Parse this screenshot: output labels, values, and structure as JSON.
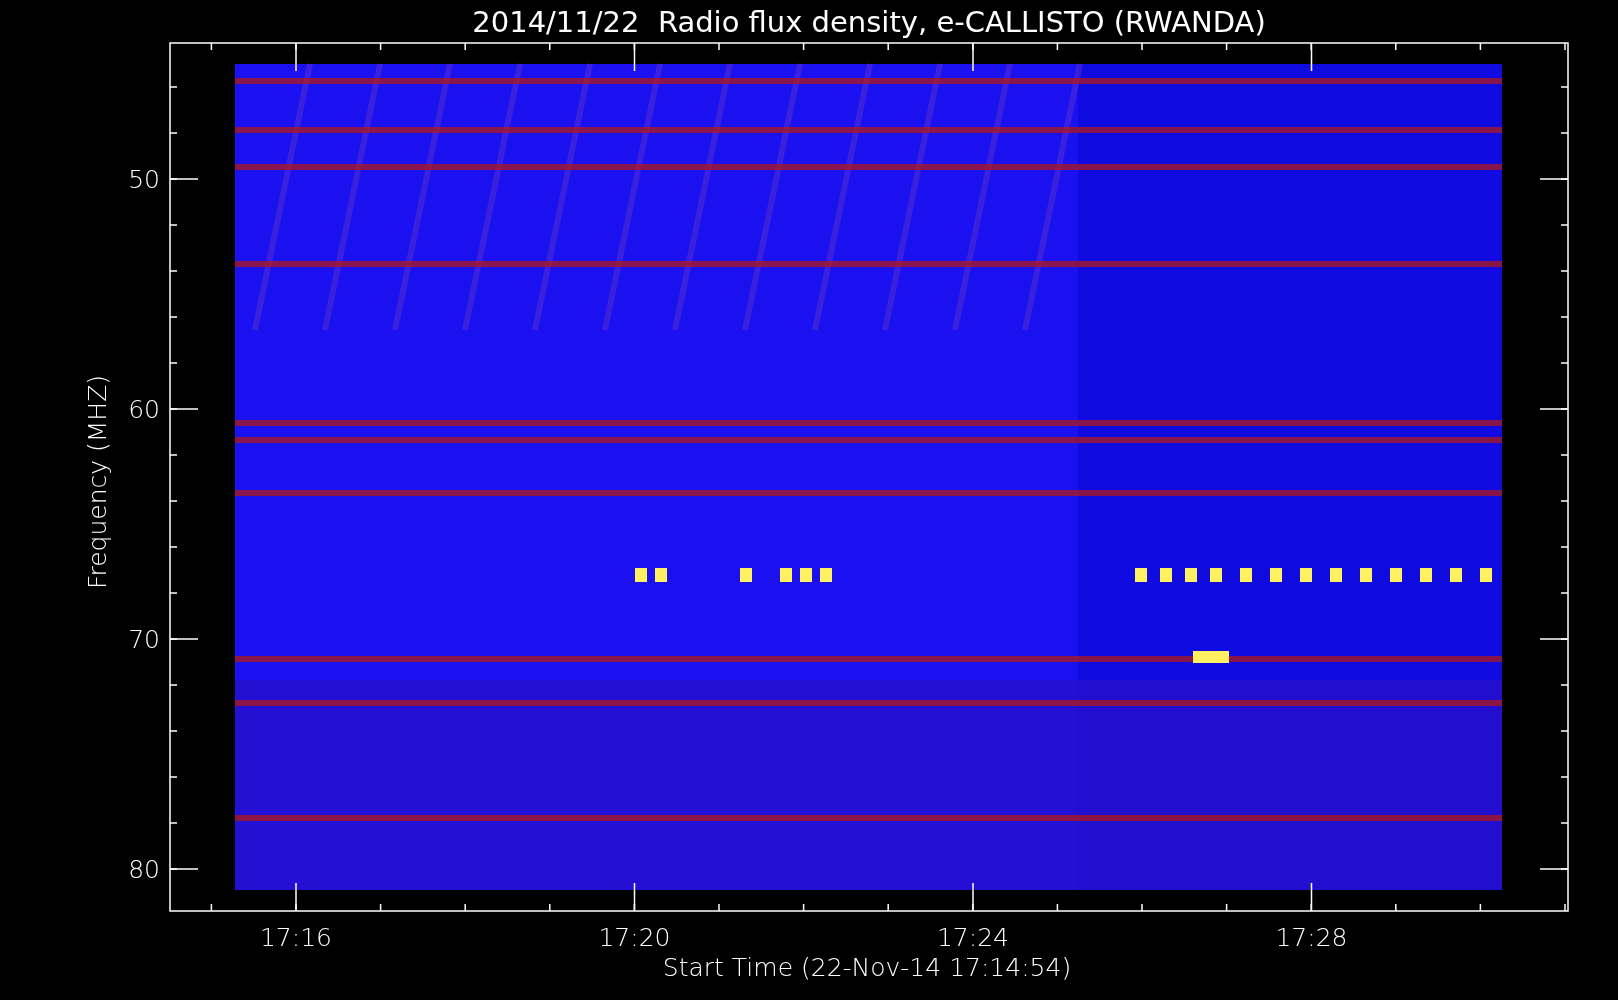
{
  "title": "2014/11/22  Radio flux density, e-CALLISTO (RWANDA)",
  "y_axis": {
    "label": "Frequency (MHZ)",
    "ticks": [
      "50",
      "60",
      "70",
      "80"
    ]
  },
  "x_axis": {
    "label": "Start Time (22-Nov-14 17:14:54)",
    "ticks": [
      "17:16",
      "17:20",
      "17:24",
      "17:28"
    ]
  }
}
